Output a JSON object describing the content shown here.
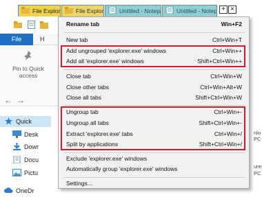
{
  "tabstrip": {
    "tabs": [
      {
        "label": "File Explorer"
      },
      {
        "label": "File Explorer"
      },
      {
        "label": "Untitled - Notepad"
      },
      {
        "label": "Untitled - Notepad"
      }
    ],
    "new_tab_glyph": "+",
    "close_glyph": "×"
  },
  "explorer": {
    "file_tab": "File",
    "home_tab_partial": "H",
    "pin_label": "Pin to Quick access",
    "tree": [
      {
        "label": "Quick"
      },
      {
        "label": "Desk"
      },
      {
        "label": "Dowr"
      },
      {
        "label": "Docu"
      },
      {
        "label": "Pictu"
      },
      {
        "label": "OneDr"
      }
    ],
    "right_fragments": [
      "nlo",
      "PC",
      "ures",
      "PC"
    ]
  },
  "menu": {
    "items": [
      {
        "label": "Rename tab",
        "shortcut": "Win+F2",
        "bold": true
      },
      {
        "label": "New tab",
        "shortcut": "Ctrl+Win+T"
      },
      {
        "label": "Add ungrouped 'explorer.exe' windows",
        "shortcut": "Ctrl+Win++"
      },
      {
        "label": "Add all 'explorer.exe' windows",
        "shortcut": "Shift+Ctrl+Win++"
      },
      {
        "label": "Close tab",
        "shortcut": "Ctrl+Win+W"
      },
      {
        "label": "Close other tabs",
        "shortcut": "Ctrl+Win+Alt+W"
      },
      {
        "label": "Close all tabs",
        "shortcut": "Shift+Ctrl+Win+W"
      },
      {
        "label": "Ungroup tab",
        "shortcut": "Ctrl+Win+-"
      },
      {
        "label": "Ungroup all tabs",
        "shortcut": "Shift+Ctrl+Win+-"
      },
      {
        "label": "Extract 'explorer.exe' tabs",
        "shortcut": "Ctrl+Win+/"
      },
      {
        "label": "Split by applications",
        "shortcut": "Shift+Ctrl+Win+/"
      },
      {
        "label": "Exclude 'explorer.exe' windows",
        "shortcut": ""
      },
      {
        "label": "Automatically group 'explorer.exe' windows",
        "shortcut": ""
      },
      {
        "label": "Settings...",
        "shortcut": ""
      }
    ]
  },
  "colors": {
    "highlight_border": "#d6192a",
    "tab_explorer": "#f0d24a",
    "tab_notepad": "#8ed0d2",
    "file_tab": "#1f6fc4",
    "menu_bg": "#f2f2f2"
  }
}
